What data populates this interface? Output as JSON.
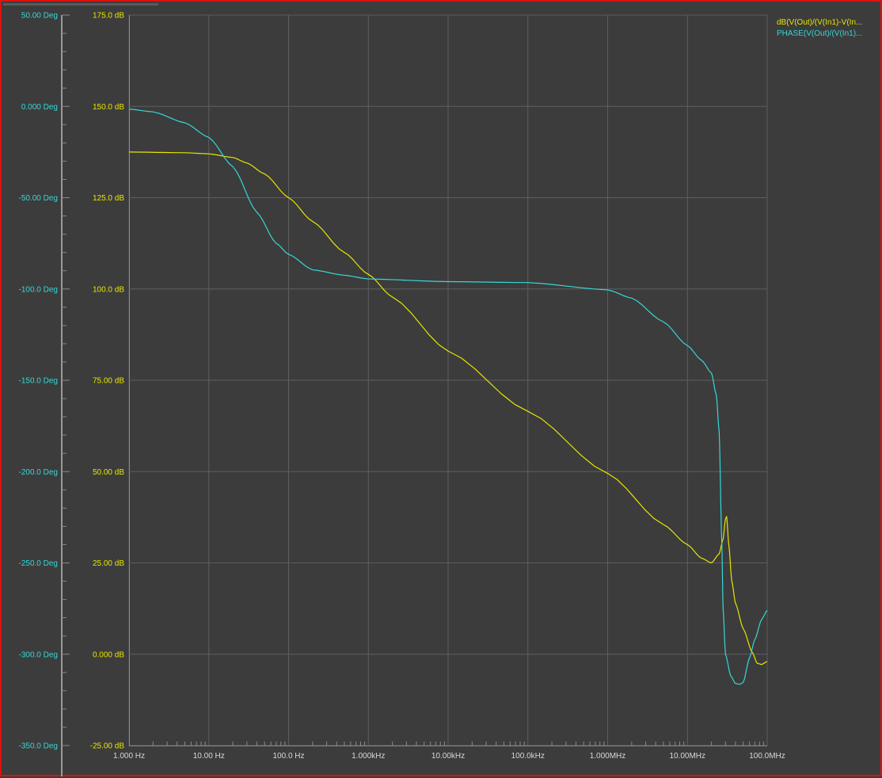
{
  "chart_data": {
    "type": "line",
    "x_scale": "log",
    "x_range_hz": [
      1,
      100000000
    ],
    "x_tick_labels": [
      "1.000 Hz",
      "10.00 Hz",
      "100.0 Hz",
      "1.000kHz",
      "10.00kHz",
      "100.0kHz",
      "1.000MHz",
      "10.00MHz",
      "100.0MHz"
    ],
    "y_left_outer": {
      "unit": "Deg",
      "range": [
        -350,
        50
      ],
      "tick_labels": [
        "50.00 Deg",
        "0.000 Deg",
        "-50.00 Deg",
        "-100.0 Deg",
        "-150.0 Deg",
        "-200.0 Deg",
        "-250.0 Deg",
        "-300.0 Deg",
        "-350.0 Deg"
      ]
    },
    "y_left_inner": {
      "unit": "dB",
      "range": [
        -25,
        175
      ],
      "tick_labels": [
        "175.0 dB",
        "150.0 dB",
        "125.0 dB",
        "100.0 dB",
        "75.00 dB",
        "50.00 dB",
        "25.00 dB",
        "0.000 dB",
        "-25.00 dB"
      ]
    },
    "grid": true,
    "legend_placement": "top-right",
    "series": [
      {
        "name": "dB(V(Out)/(V(In1)-V(In...",
        "axis": "dB",
        "color": "#e6e600",
        "points": [
          [
            1,
            137.5
          ],
          [
            5,
            137.3
          ],
          [
            10,
            137.0
          ],
          [
            20,
            136.0
          ],
          [
            30,
            134.5
          ],
          [
            50,
            131.5
          ],
          [
            100,
            125.0
          ],
          [
            200,
            118.5
          ],
          [
            500,
            110.0
          ],
          [
            1000,
            104.0
          ],
          [
            2000,
            97.8
          ],
          [
            10000,
            83.0
          ],
          [
            100000,
            66.5
          ],
          [
            1000000,
            49.5
          ],
          [
            5000000,
            35.5
          ],
          [
            10000000,
            30.0
          ],
          [
            15000000,
            26.3
          ],
          [
            20000000,
            25.0
          ],
          [
            25000000,
            27.5
          ],
          [
            28000000,
            31.5
          ],
          [
            30000000,
            37.0
          ],
          [
            31000000,
            37.7
          ],
          [
            33000000,
            30.0
          ],
          [
            36000000,
            20.0
          ],
          [
            40000000,
            14.0
          ],
          [
            50000000,
            7.0
          ],
          [
            65000000,
            0.5
          ],
          [
            75000000,
            -2.5
          ],
          [
            85000000,
            -2.8
          ],
          [
            100000000,
            -2.0
          ]
        ]
      },
      {
        "name": "PHASE(V(Out)/(V(In1)...",
        "axis": "Deg",
        "color": "#37d7d7",
        "points": [
          [
            1,
            -1.5
          ],
          [
            2,
            -3.0
          ],
          [
            5,
            -9.0
          ],
          [
            10,
            -17.0
          ],
          [
            20,
            -33.0
          ],
          [
            40,
            -58.0
          ],
          [
            70,
            -75.0
          ],
          [
            100,
            -81.0
          ],
          [
            200,
            -89.5
          ],
          [
            500,
            -92.5
          ],
          [
            1000,
            -94.5
          ],
          [
            10000,
            -96.0
          ],
          [
            100000,
            -96.5
          ],
          [
            1000000,
            -100.5
          ],
          [
            2000000,
            -105.0
          ],
          [
            5000000,
            -118.0
          ],
          [
            10000000,
            -131.0
          ],
          [
            15000000,
            -139.0
          ],
          [
            20000000,
            -146.0
          ],
          [
            23000000,
            -158.0
          ],
          [
            25000000,
            -178.0
          ],
          [
            27000000,
            -240.0
          ],
          [
            28000000,
            -275.0
          ],
          [
            30000000,
            -300.0
          ],
          [
            35000000,
            -312.0
          ],
          [
            40000000,
            -316.0
          ],
          [
            45000000,
            -316.5
          ],
          [
            50000000,
            -315.5
          ],
          [
            60000000,
            -302.0
          ],
          [
            70000000,
            -292.0
          ],
          [
            85000000,
            -281.0
          ],
          [
            100000000,
            -276.0
          ]
        ]
      }
    ]
  }
}
